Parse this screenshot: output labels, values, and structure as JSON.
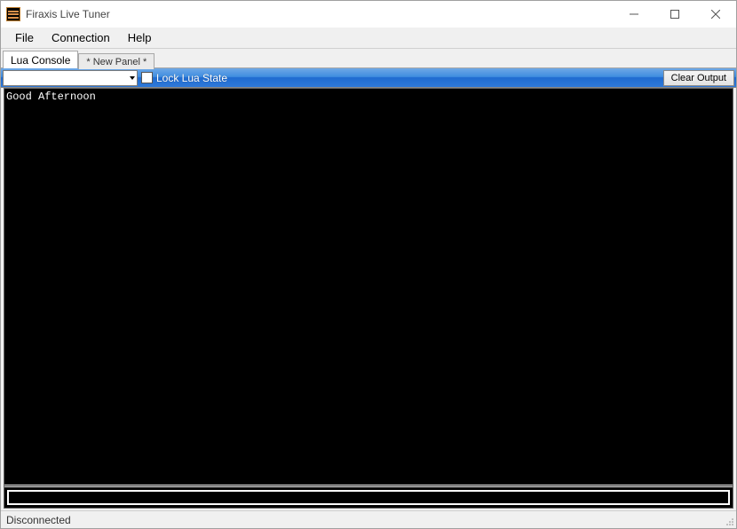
{
  "window": {
    "title": "Firaxis Live Tuner"
  },
  "menu": {
    "items": [
      "File",
      "Connection",
      "Help"
    ]
  },
  "tabs": {
    "items": [
      {
        "label": "Lua Console",
        "active": true
      },
      {
        "label": "* New Panel *",
        "active": false
      }
    ]
  },
  "toolbar": {
    "combo_value": "",
    "lock_label": "Lock Lua State",
    "clear_label": "Clear Output"
  },
  "console": {
    "output": "Good Afternoon",
    "input_value": ""
  },
  "status": {
    "text": "Disconnected"
  }
}
